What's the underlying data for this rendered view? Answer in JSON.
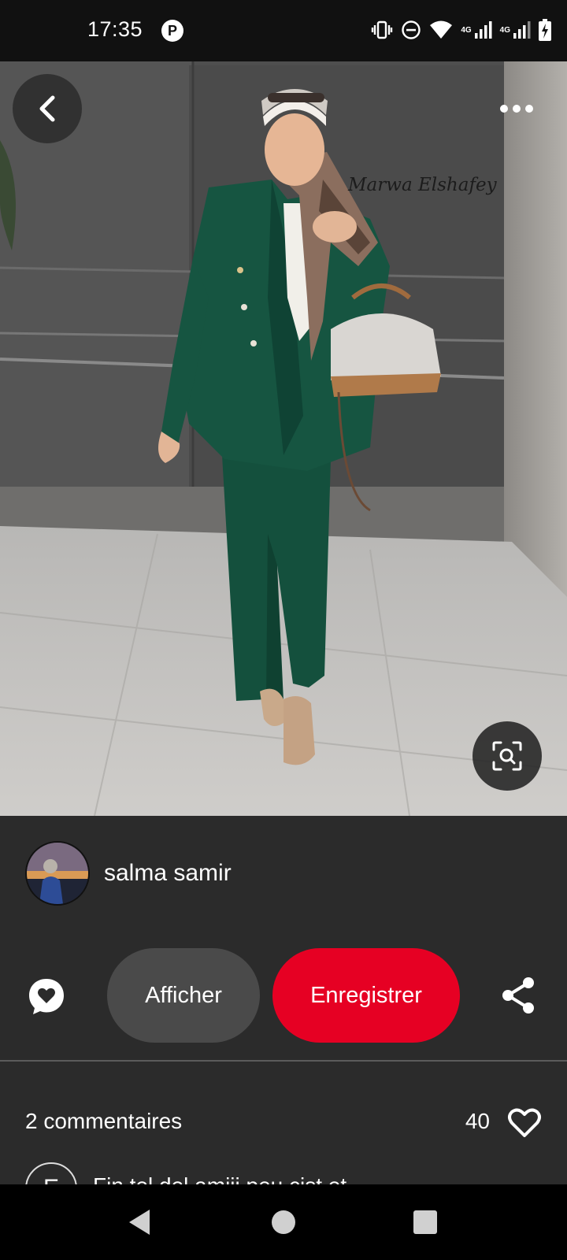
{
  "status_bar": {
    "time": "17:35",
    "app_icon_letter": "P",
    "network_label_1": "4G",
    "network_label_2": "4G",
    "icons": [
      "vibrate-icon",
      "do-not-disturb-icon",
      "wifi-icon",
      "signal-icon",
      "signal-icon",
      "battery-charging-icon"
    ]
  },
  "photo": {
    "watermark": "Marwa Elshafey",
    "icons": [
      "back-icon",
      "more-icon",
      "visual-search-icon"
    ]
  },
  "author": {
    "name": "salma samir"
  },
  "actions": {
    "view_label": "Afficher",
    "save_label": "Enregistrer",
    "icons": [
      "comment-heart-icon",
      "share-icon"
    ]
  },
  "engagement": {
    "comments_label": "2 commentaires",
    "likes_count": "40"
  },
  "comment_preview": {
    "avatar_letter": "E",
    "text": "Fin tel del amiji peu cist et"
  },
  "colors": {
    "save_button": "#e60023",
    "view_button": "#4a4a4a",
    "sheet_background": "#2b2b2b",
    "status_bar": "#111111"
  },
  "navigation": {
    "icons": [
      "nav-back-icon",
      "nav-home-icon",
      "nav-recents-icon"
    ]
  }
}
